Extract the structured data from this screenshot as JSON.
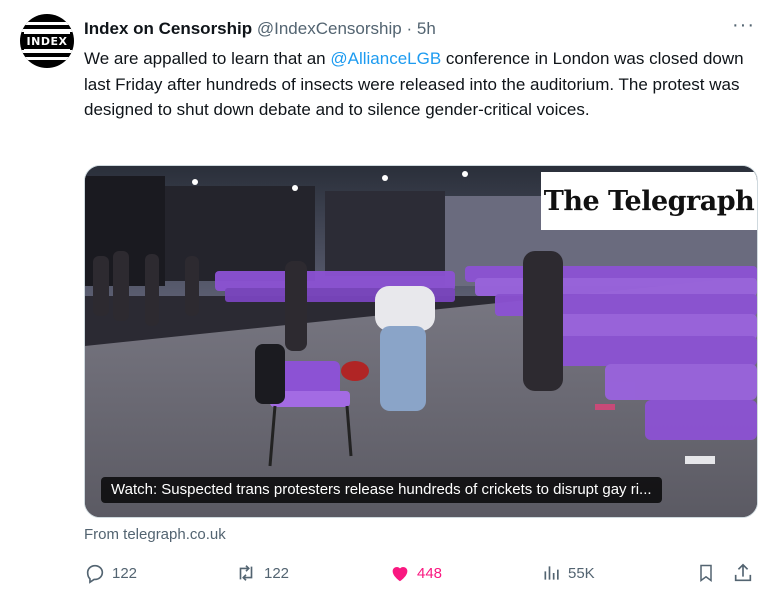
{
  "tweet": {
    "author_name": "Index on Censorship",
    "handle": "@IndexCensorship",
    "separator": "·",
    "time": "5h",
    "more_label": "···",
    "avatar_text": "INDEX",
    "text_before": "We are appalled to learn that an ",
    "mention": "@AllianceLGB",
    "text_after": " conference in London was closed down last Friday after hundreds of insects were released into the auditorium. The protest was designed to shut down debate and to silence gender-critical voices."
  },
  "media": {
    "brand": "The Telegraph",
    "caption": "Watch: Suspected trans protesters release hundreds of crickets to disrupt gay ri..."
  },
  "card": {
    "source": "From telegraph.co.uk"
  },
  "actions": {
    "replies": "122",
    "reposts": "122",
    "likes": "448",
    "views": "55K"
  },
  "colors": {
    "accent": "#1d9bf0",
    "like": "#f91880",
    "muted": "#536471",
    "chair": "#8c52d4"
  }
}
